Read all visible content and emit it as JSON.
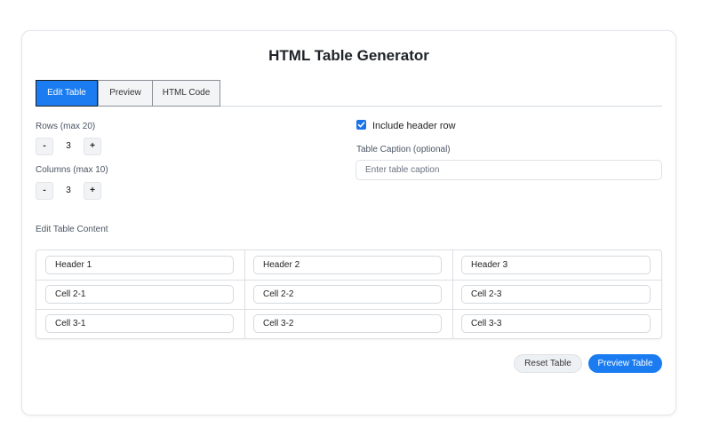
{
  "app": {
    "title": "HTML Table Generator"
  },
  "tabs": [
    {
      "label": "Edit Table",
      "active": true
    },
    {
      "label": "Preview",
      "active": false
    },
    {
      "label": "HTML Code",
      "active": false
    }
  ],
  "rows": {
    "label": "Rows (max 20)",
    "value": "3",
    "minus": "-",
    "plus": "+"
  },
  "columns": {
    "label": "Columns (max 10)",
    "value": "3",
    "minus": "-",
    "plus": "+"
  },
  "header_row": {
    "label": "Include header row",
    "checked": true
  },
  "caption": {
    "label": "Table Caption (optional)",
    "placeholder": "Enter table caption",
    "value": ""
  },
  "content": {
    "label": "Edit Table Content",
    "cells": [
      [
        "Header 1",
        "Header 2",
        "Header 3"
      ],
      [
        "Cell 2-1",
        "Cell 2-2",
        "Cell 2-3"
      ],
      [
        "Cell 3-1",
        "Cell 3-2",
        "Cell 3-3"
      ]
    ]
  },
  "actions": {
    "reset": "Reset Table",
    "preview": "Preview Table"
  },
  "colors": {
    "accent": "#1a7cf0",
    "border": "#dcdfe3"
  }
}
